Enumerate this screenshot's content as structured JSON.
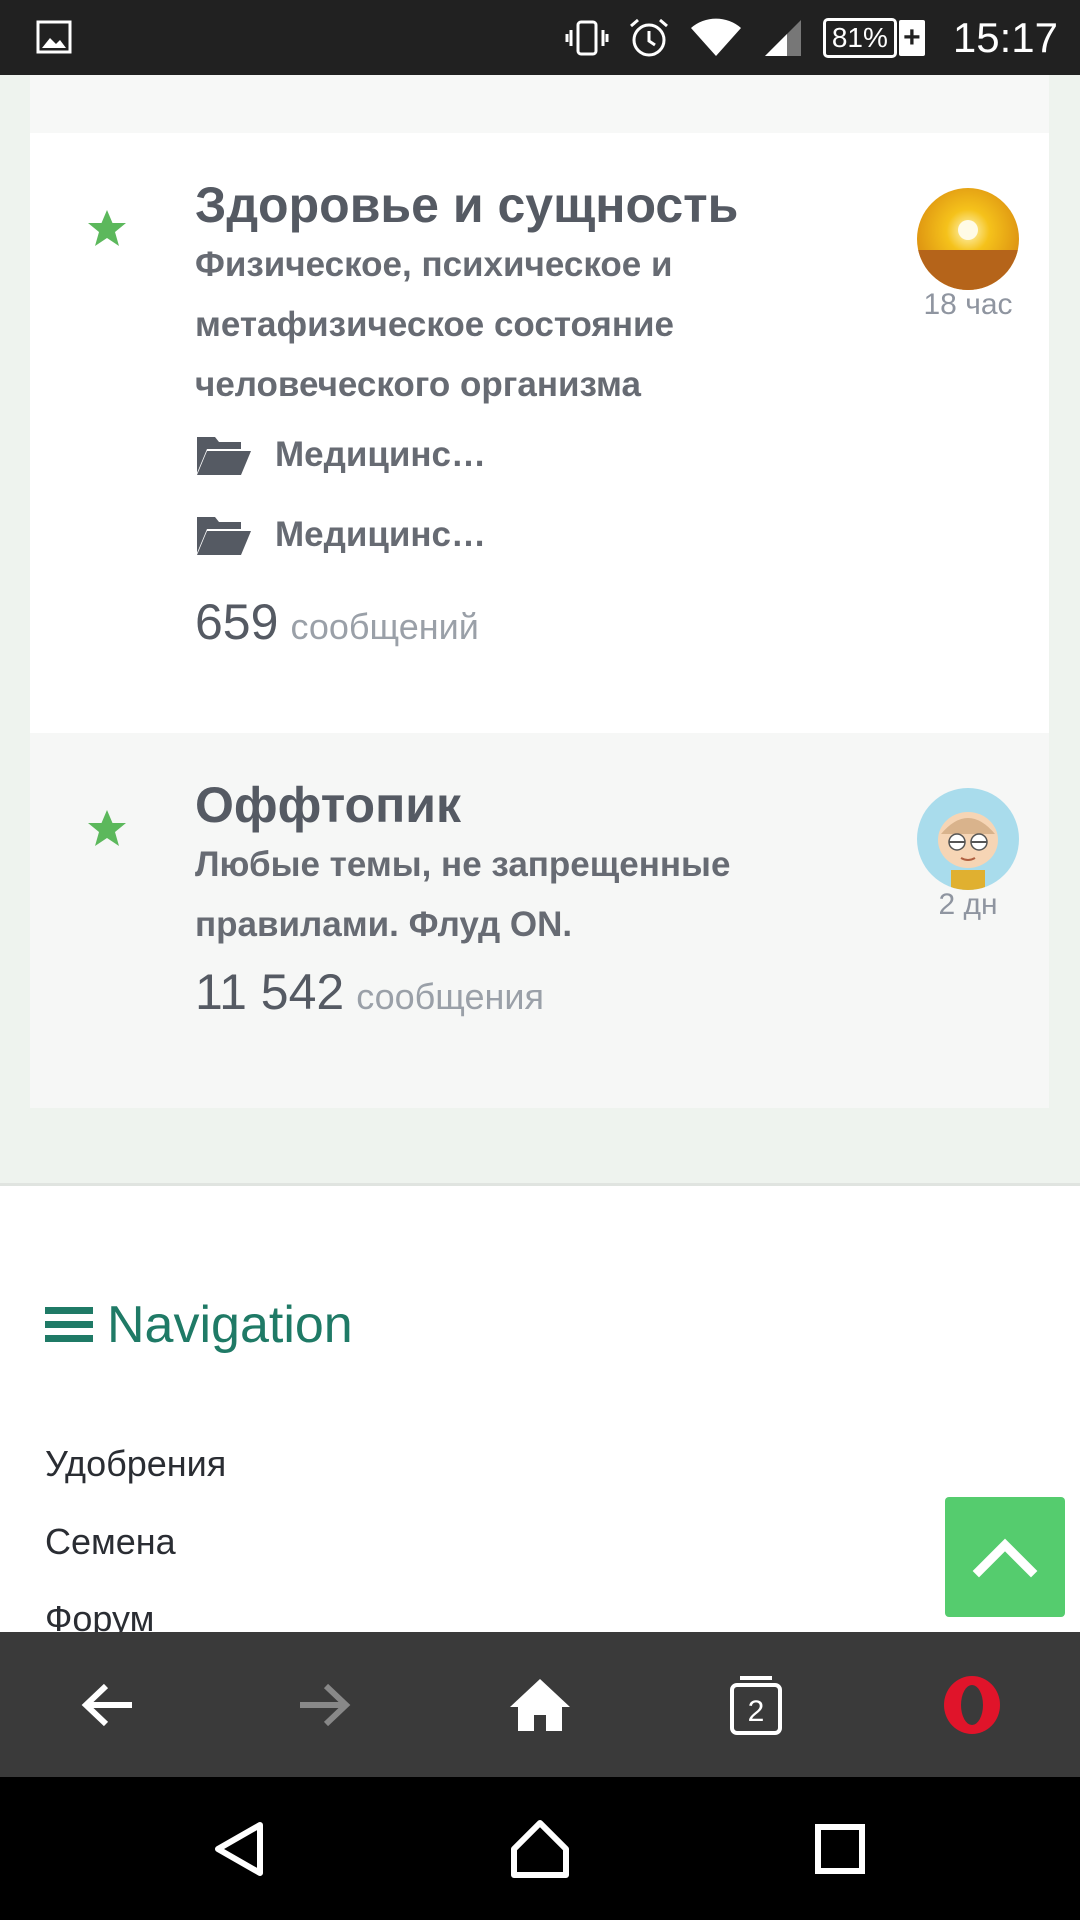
{
  "status_bar": {
    "battery_percent": "81%",
    "battery_charging_symbol": "+",
    "time": "15:17",
    "icons": [
      "image-icon",
      "vibrate-icon",
      "alarm-icon",
      "wifi-icon",
      "signal-icon",
      "battery-icon"
    ]
  },
  "forums": [
    {
      "title": "Здоровье и сущность",
      "description": "Физическое, психическое и метафизическое состояние человеческого организма",
      "subforums": [
        "Медицинс…",
        "Медицинс…"
      ],
      "count": "659",
      "count_label": "сообщений",
      "last_post_time": "18 час",
      "avatar": "sun-avatar"
    },
    {
      "title": "Оффтопик",
      "description": "Любые темы, не запрещенные правилами. Флуд ON.",
      "count": "11 542",
      "count_label": "сообщения",
      "last_post_time": "2 дн",
      "avatar": "cartoon-avatar"
    }
  ],
  "navigation": {
    "title": "Navigation",
    "items": [
      "Удобрения",
      "Семена",
      "Форум"
    ]
  },
  "browser_bar": {
    "tabs_count": "2",
    "items": [
      "back-icon",
      "forward-icon",
      "home-icon",
      "tabs-icon",
      "opera-icon"
    ]
  },
  "colors": {
    "star": "#5cb85c",
    "nav_title": "#1f7a66",
    "scroll_top_button": "#55cc6e"
  }
}
